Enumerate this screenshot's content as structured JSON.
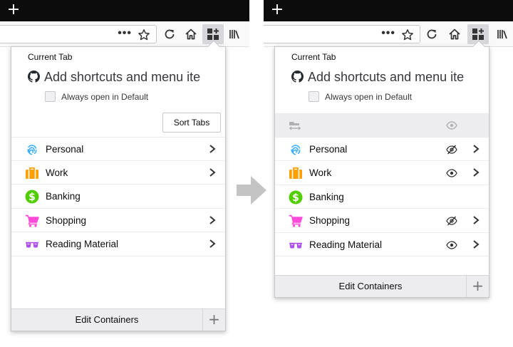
{
  "tab_strip": {
    "new_tab_icon": "plus-icon",
    "new_tab_glyph": "+"
  },
  "toolbar": {
    "page_actions_glyph": "•••",
    "icons": [
      "page-actions-icon",
      "bookmark-star-icon",
      "reload-icon",
      "home-icon",
      "multi-account-containers-icon",
      "library-icon"
    ]
  },
  "before": {
    "current_tab": {
      "title": "Current Tab",
      "tab_name": "Add shortcuts and menu ite",
      "always_open_label": "Always open in Default",
      "always_open_checked": false
    },
    "sort_tabs_label": "Sort Tabs",
    "containers": [
      {
        "name": "Personal",
        "icon": "fingerprint-icon",
        "color": "#37adff",
        "has_chevron": true
      },
      {
        "name": "Work",
        "icon": "briefcase-icon",
        "color": "#ff9f00",
        "has_chevron": true
      },
      {
        "name": "Banking",
        "icon": "dollar-icon",
        "color": "#51cd00",
        "has_chevron": false
      },
      {
        "name": "Shopping",
        "icon": "cart-icon",
        "color": "#ff4bda",
        "has_chevron": true
      },
      {
        "name": "Reading Material",
        "icon": "glasses-icon",
        "color": "#af51f5",
        "has_chevron": true
      }
    ],
    "footer": {
      "edit_label": "Edit Containers",
      "add_glyph": "+"
    }
  },
  "after": {
    "current_tab": {
      "title": "Current Tab",
      "tab_name": "Add shortcuts and menu ite",
      "always_open_label": "Always open in Default",
      "always_open_checked": false
    },
    "hide_row": {
      "icon": "hide-tabs-icon",
      "eye": "eye-icon"
    },
    "containers": [
      {
        "name": "Personal",
        "icon": "fingerprint-icon",
        "color": "#37adff",
        "eye": "eye-slash-icon",
        "has_chevron": true
      },
      {
        "name": "Work",
        "icon": "briefcase-icon",
        "color": "#ff9f00",
        "eye": "eye-icon",
        "has_chevron": true
      },
      {
        "name": "Banking",
        "icon": "dollar-icon",
        "color": "#51cd00",
        "eye": "",
        "has_chevron": false
      },
      {
        "name": "Shopping",
        "icon": "cart-icon",
        "color": "#ff4bda",
        "eye": "eye-slash-icon",
        "has_chevron": true
      },
      {
        "name": "Reading Material",
        "icon": "glasses-icon",
        "color": "#af51f5",
        "eye": "eye-icon",
        "has_chevron": true
      }
    ],
    "footer": {
      "edit_label": "Edit Containers",
      "add_glyph": "+"
    }
  },
  "transition_arrow": "arrow-right-icon"
}
